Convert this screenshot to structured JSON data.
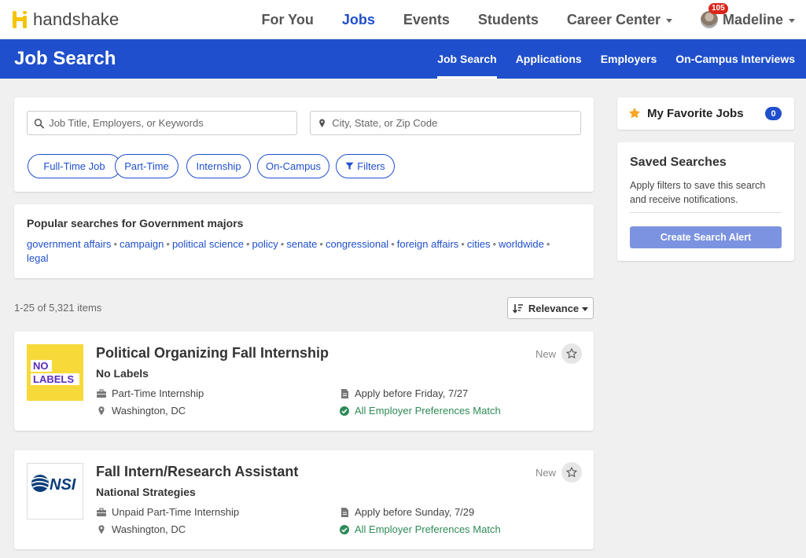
{
  "brand": {
    "name": "handshake",
    "color": "#f5c400"
  },
  "topnav": {
    "links": [
      {
        "label": "For You"
      },
      {
        "label": "Jobs"
      },
      {
        "label": "Events"
      },
      {
        "label": "Students"
      },
      {
        "label": "Career Center"
      }
    ],
    "user": {
      "name": "Madeline",
      "notifications": "105"
    }
  },
  "subheader": {
    "title": "Job Search",
    "tabs": [
      {
        "label": "Job Search"
      },
      {
        "label": "Applications"
      },
      {
        "label": "Employers"
      },
      {
        "label": "On-Campus Interviews"
      }
    ]
  },
  "search": {
    "keywords_placeholder": "Job Title, Employers, or Keywords",
    "location_placeholder": "City, State, or Zip Code",
    "filters": [
      "Full-Time Job",
      "Part-Time",
      "Internship",
      "On-Campus",
      "Filters"
    ]
  },
  "popular": {
    "title": "Popular searches for Government majors",
    "terms": [
      "government affairs",
      "campaign",
      "political science",
      "policy",
      "senate",
      "congressional",
      "foreign affairs",
      "cities",
      "worldwide",
      "legal"
    ]
  },
  "results": {
    "count_text": "1-25 of 5,321 items",
    "sort_label": "Relevance"
  },
  "jobs": [
    {
      "title": "Political Organizing Fall Internship",
      "employer": "No Labels",
      "logo_text": [
        "NO",
        "LABELS"
      ],
      "type": "Part-Time Internship",
      "location": "Washington, DC",
      "deadline": "Apply before Friday, 7/27",
      "match": "All Employer Preferences Match",
      "badge": "New"
    },
    {
      "title": "Fall Intern/Research Assistant",
      "employer": "National Strategies",
      "logo_text": [
        "NSI"
      ],
      "type": "Unpaid Part-Time Internship",
      "location": "Washington, DC",
      "deadline": "Apply before Sunday, 7/29",
      "match": "All Employer Preferences Match",
      "badge": "New"
    }
  ],
  "favorites": {
    "title": "My Favorite Jobs",
    "count": "0"
  },
  "saved_searches": {
    "title": "Saved Searches",
    "description": "Apply filters to save this search and receive notifications.",
    "button_label": "Create Search Alert"
  },
  "colors": {
    "primary": "#1f4fcc",
    "success": "#2e8b57",
    "alert_button": "#7b93e0",
    "no_labels_yellow": "#f8d93a",
    "no_labels_purple": "#5b2bbf"
  }
}
